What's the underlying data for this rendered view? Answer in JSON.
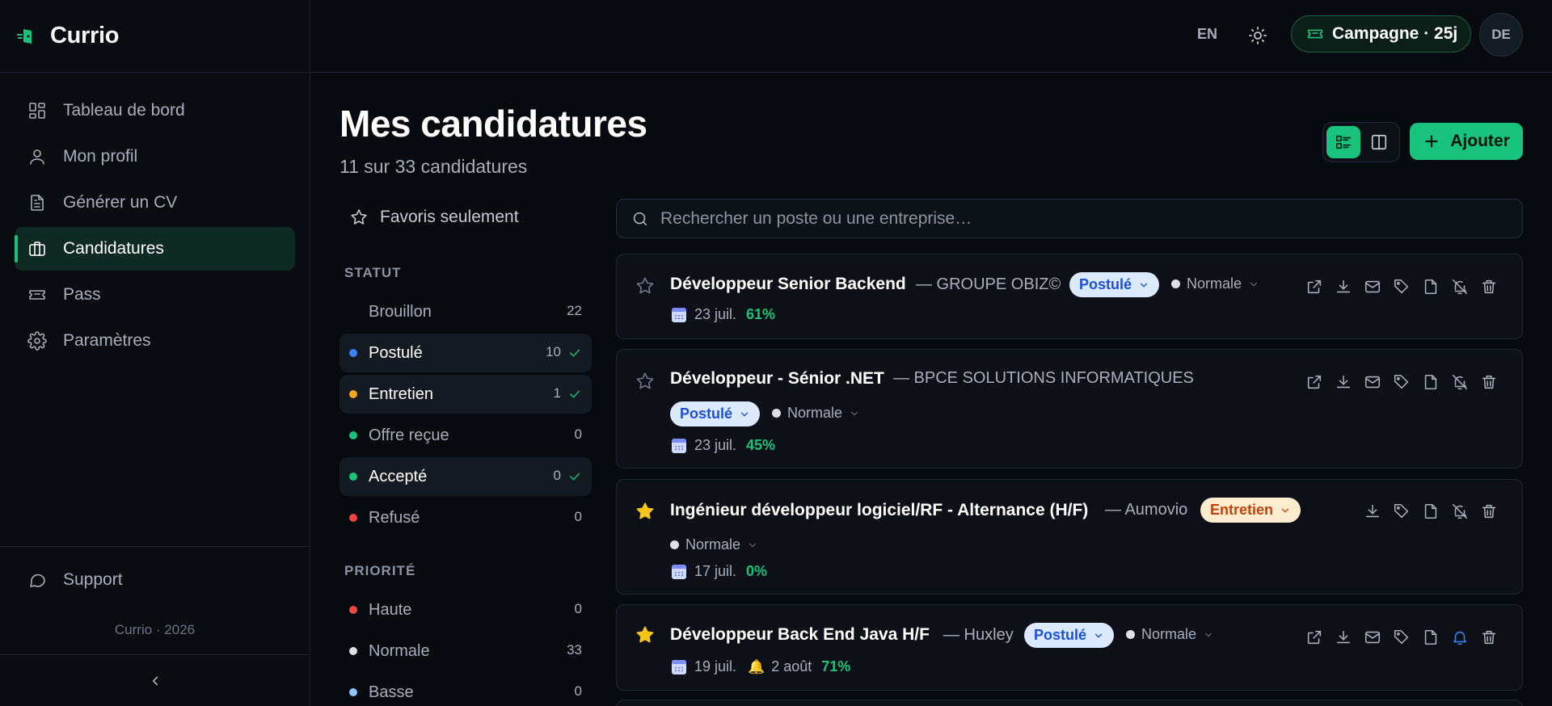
{
  "app": {
    "name": "Currio",
    "copyright": "Currio · 2026"
  },
  "sidebar": {
    "items": [
      {
        "label": "Tableau de bord",
        "icon": "dashboard-icon"
      },
      {
        "label": "Mon profil",
        "icon": "user-icon"
      },
      {
        "label": "Générer un CV",
        "icon": "document-icon"
      },
      {
        "label": "Candidatures",
        "icon": "briefcase-icon",
        "active": true
      },
      {
        "label": "Pass",
        "icon": "ticket-icon"
      },
      {
        "label": "Paramètres",
        "icon": "gear-icon"
      }
    ],
    "support_label": "Support"
  },
  "topbar": {
    "lang": "EN",
    "campaign_label": "Campagne · 25j",
    "avatar_initials": "DE"
  },
  "page": {
    "title": "Mes candidatures",
    "subtitle": "11 sur 33 candidatures",
    "add_label": "Ajouter"
  },
  "filters": {
    "favorites_label": "Favoris seulement",
    "status_heading": "STATUT",
    "status": [
      {
        "label": "Brouillon",
        "count": "22",
        "color": "",
        "selected": false
      },
      {
        "label": "Postulé",
        "count": "10",
        "color": "#3b82f6",
        "selected": true
      },
      {
        "label": "Entretien",
        "count": "1",
        "color": "#f5a524",
        "selected": true
      },
      {
        "label": "Offre reçue",
        "count": "0",
        "color": "#19c37d",
        "selected": false
      },
      {
        "label": "Accepté",
        "count": "0",
        "color": "#19c37d",
        "selected": true
      },
      {
        "label": "Refusé",
        "count": "0",
        "color": "#ef4444",
        "selected": false
      }
    ],
    "priority_heading": "PRIORITÉ",
    "priority": [
      {
        "label": "Haute",
        "count": "0",
        "color": "#ef4444"
      },
      {
        "label": "Normale",
        "count": "33",
        "color": "#dde1e6"
      },
      {
        "label": "Basse",
        "count": "0",
        "color": "#93c5fd"
      }
    ]
  },
  "search": {
    "placeholder": "Rechercher un poste ou une entreprise…"
  },
  "applications": [
    {
      "title": "Développeur Senior Backend",
      "company": "— GROUPE OBIZ©",
      "status": "Postulé",
      "priority": "Normale",
      "date": "23 juil.",
      "score": "61%",
      "favorite": false
    },
    {
      "title": "Développeur - Sénior .NET",
      "company": "— BPCE SOLUTIONS INFORMATIQUES",
      "status": "Postulé",
      "priority": "Normale",
      "date": "23 juil.",
      "score": "45%",
      "favorite": false
    },
    {
      "title": "Ingénieur développeur logiciel/RF - Alternance (H/F)",
      "company": "— Aumovio",
      "status": "Entretien",
      "priority": "Normale",
      "date": "17 juil.",
      "score": "0%",
      "favorite": true
    },
    {
      "title": "Développeur Back End Java H/F",
      "company": "— Huxley",
      "status": "Postulé",
      "priority": "Normale",
      "date": "19 juil.",
      "reminder": "2 août",
      "score": "71%",
      "favorite": true
    }
  ]
}
